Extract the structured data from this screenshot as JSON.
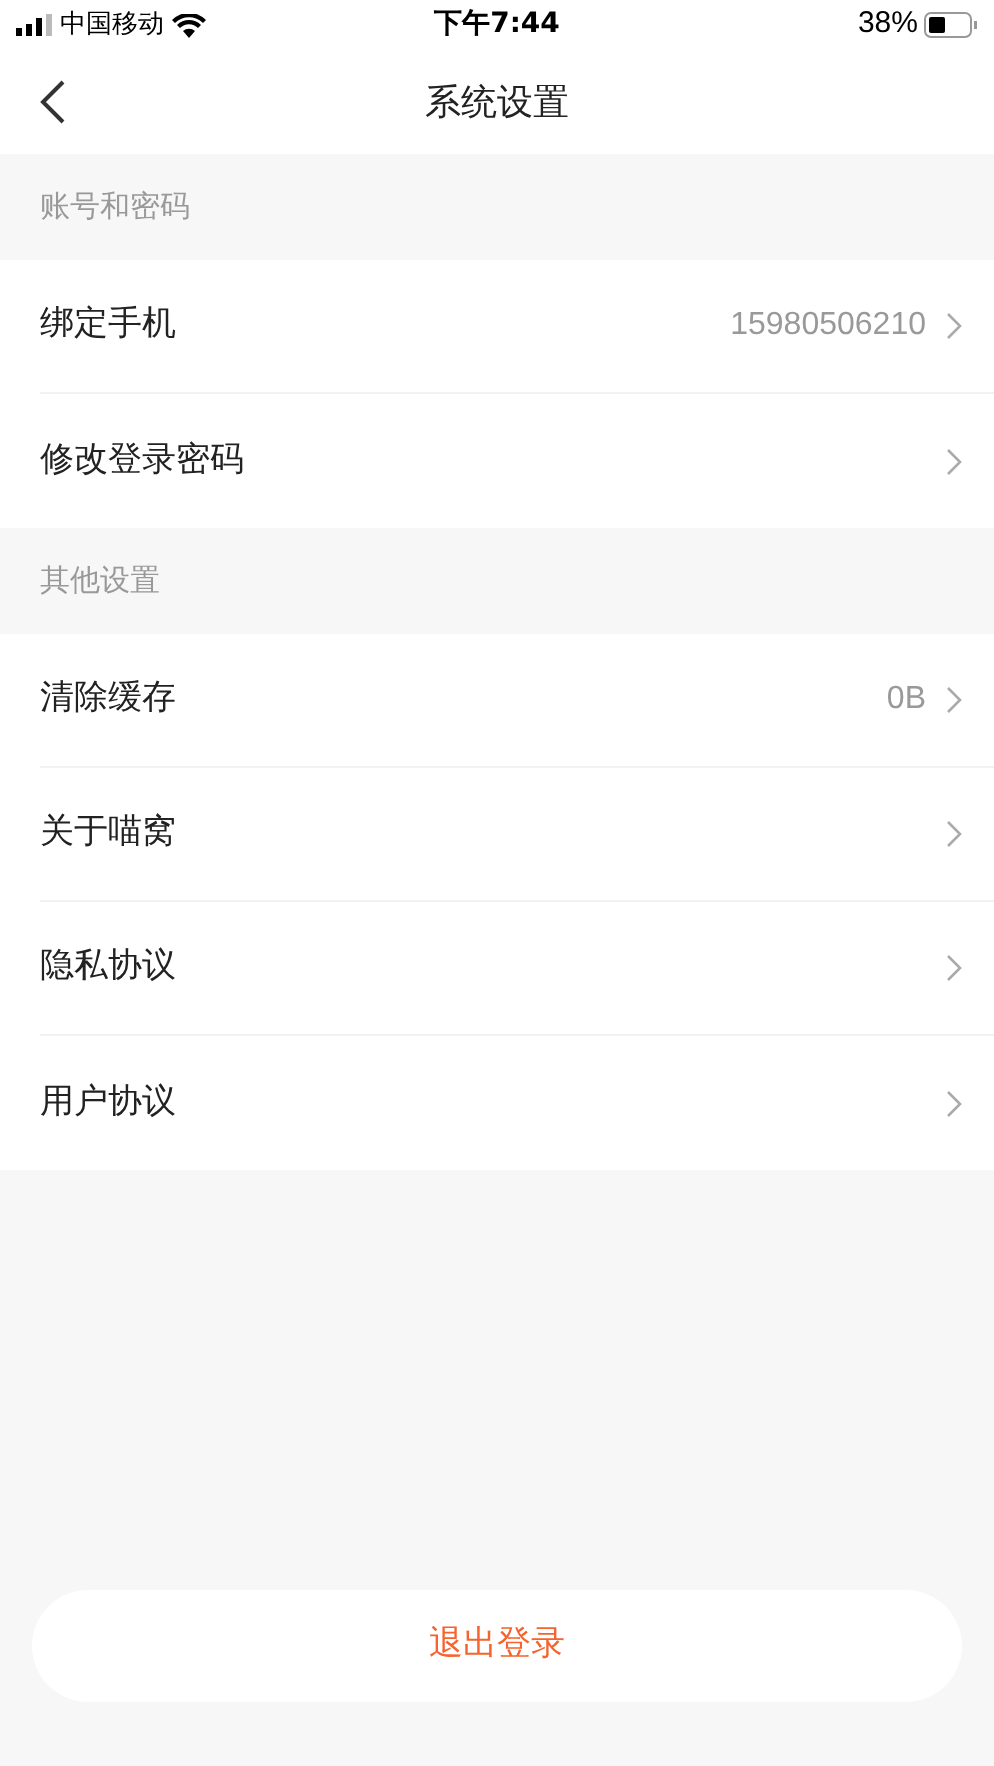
{
  "status_bar": {
    "carrier": "中国移动",
    "time": "下午7:44",
    "battery": "38%"
  },
  "nav": {
    "title": "系统设置"
  },
  "sections": [
    {
      "title": "账号和密码",
      "rows": [
        {
          "label": "绑定手机",
          "value": "15980506210"
        },
        {
          "label": "修改登录密码"
        }
      ]
    },
    {
      "title": "其他设置",
      "rows": [
        {
          "label": "清除缓存",
          "value": "0B"
        },
        {
          "label": "关于喵窝"
        },
        {
          "label": "隐私协议"
        },
        {
          "label": "用户协议"
        }
      ]
    }
  ],
  "logout_button": "退出登录"
}
